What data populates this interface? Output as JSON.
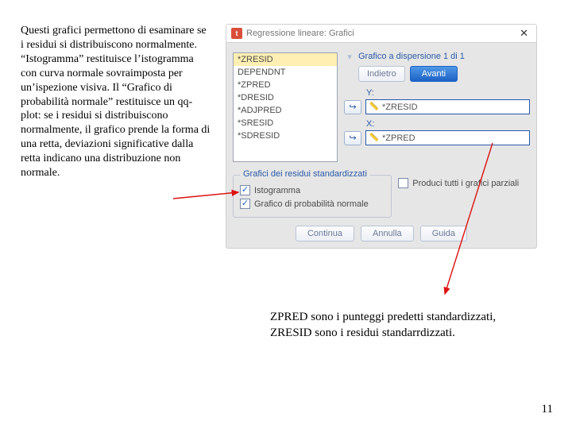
{
  "left_paragraph": "Questi grafici permettono di esaminare se i residui si distribuiscono normalmente. “Istogramma” restituisce l’istogramma con curva normale sovraimposta per un’ispezione visiva. Il “Grafico di probabilità normale” restituisce un qq-plot: se i residui si distribuiscono normalmente, il grafico prende la forma di una retta, deviazioni significative dalla retta indicano una distribuzione non normale.",
  "dialog": {
    "title": "Regressione lineare: Grafici",
    "list": [
      "*ZRESID",
      "DEPENDNT",
      "*ZPRED",
      "*DRESID",
      "*ADJPRED",
      "*SRESID",
      "*SDRESID"
    ],
    "scatter_label": "Grafico a dispersione 1 di 1",
    "nav_back": "Indietro",
    "nav_next": "Avanti",
    "y_label": "Y:",
    "x_label": "X:",
    "y_value": "*ZRESID",
    "x_value": "*ZPRED",
    "group_resid_legend": "Grafici dei residui standardizzati",
    "chk_partial": "Produci tutti i grafici parziali",
    "chk_hist": "Istogramma",
    "chk_qq": "Grafico di probabilità normale",
    "btn_continue": "Continua",
    "btn_cancel": "Annulla",
    "btn_help": "Guida"
  },
  "bottom_text_line1": "ZPRED sono i punteggi predetti standardizzati,",
  "bottom_text_line2": "ZRESID sono i residui standarrdizzati.",
  "page_number": "11"
}
